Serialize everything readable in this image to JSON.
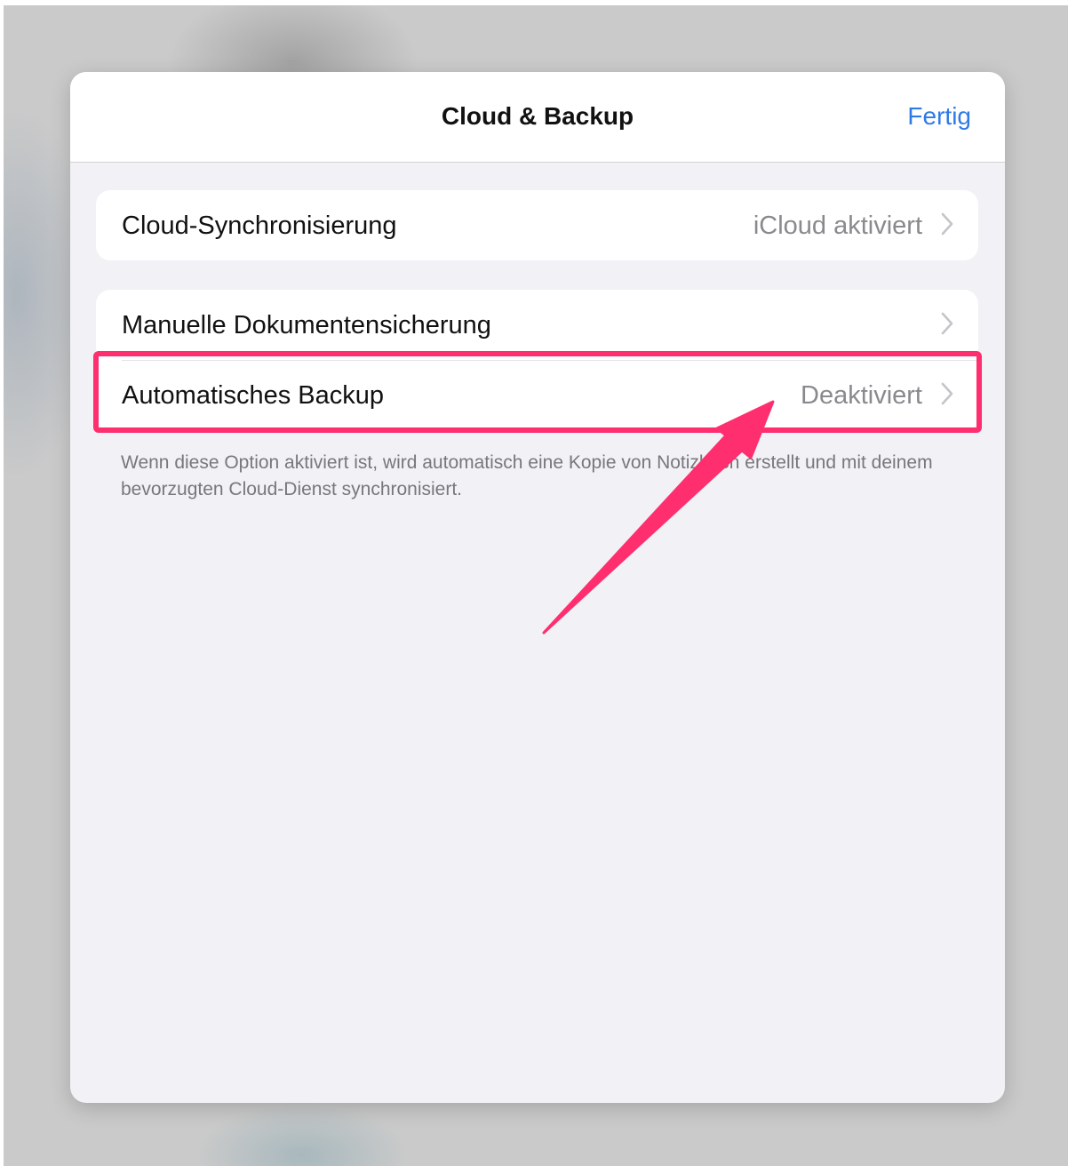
{
  "navbar": {
    "title": "Cloud & Backup",
    "done_label": "Fertig"
  },
  "groups": [
    {
      "rows": [
        {
          "label": "Cloud-Synchronisierung",
          "value": "iCloud aktiviert"
        }
      ]
    },
    {
      "rows": [
        {
          "label": "Manuelle Dokumentensicherung",
          "value": ""
        },
        {
          "label": "Automatisches Backup",
          "value": "Deaktiviert"
        }
      ],
      "footer": "Wenn diese Option aktiviert ist, wird automatisch eine Kopie von Notizbuch erstellt und mit deinem bevorzugten Cloud-Dienst synchronisiert."
    }
  ],
  "colors": {
    "accent": "#2f7ae5",
    "annotation": "#ff2e6e",
    "sheet_background": "#f1f1f6"
  },
  "icons": {
    "chevron": "chevron-right-icon",
    "annotation_arrow": "arrow-annotation"
  }
}
